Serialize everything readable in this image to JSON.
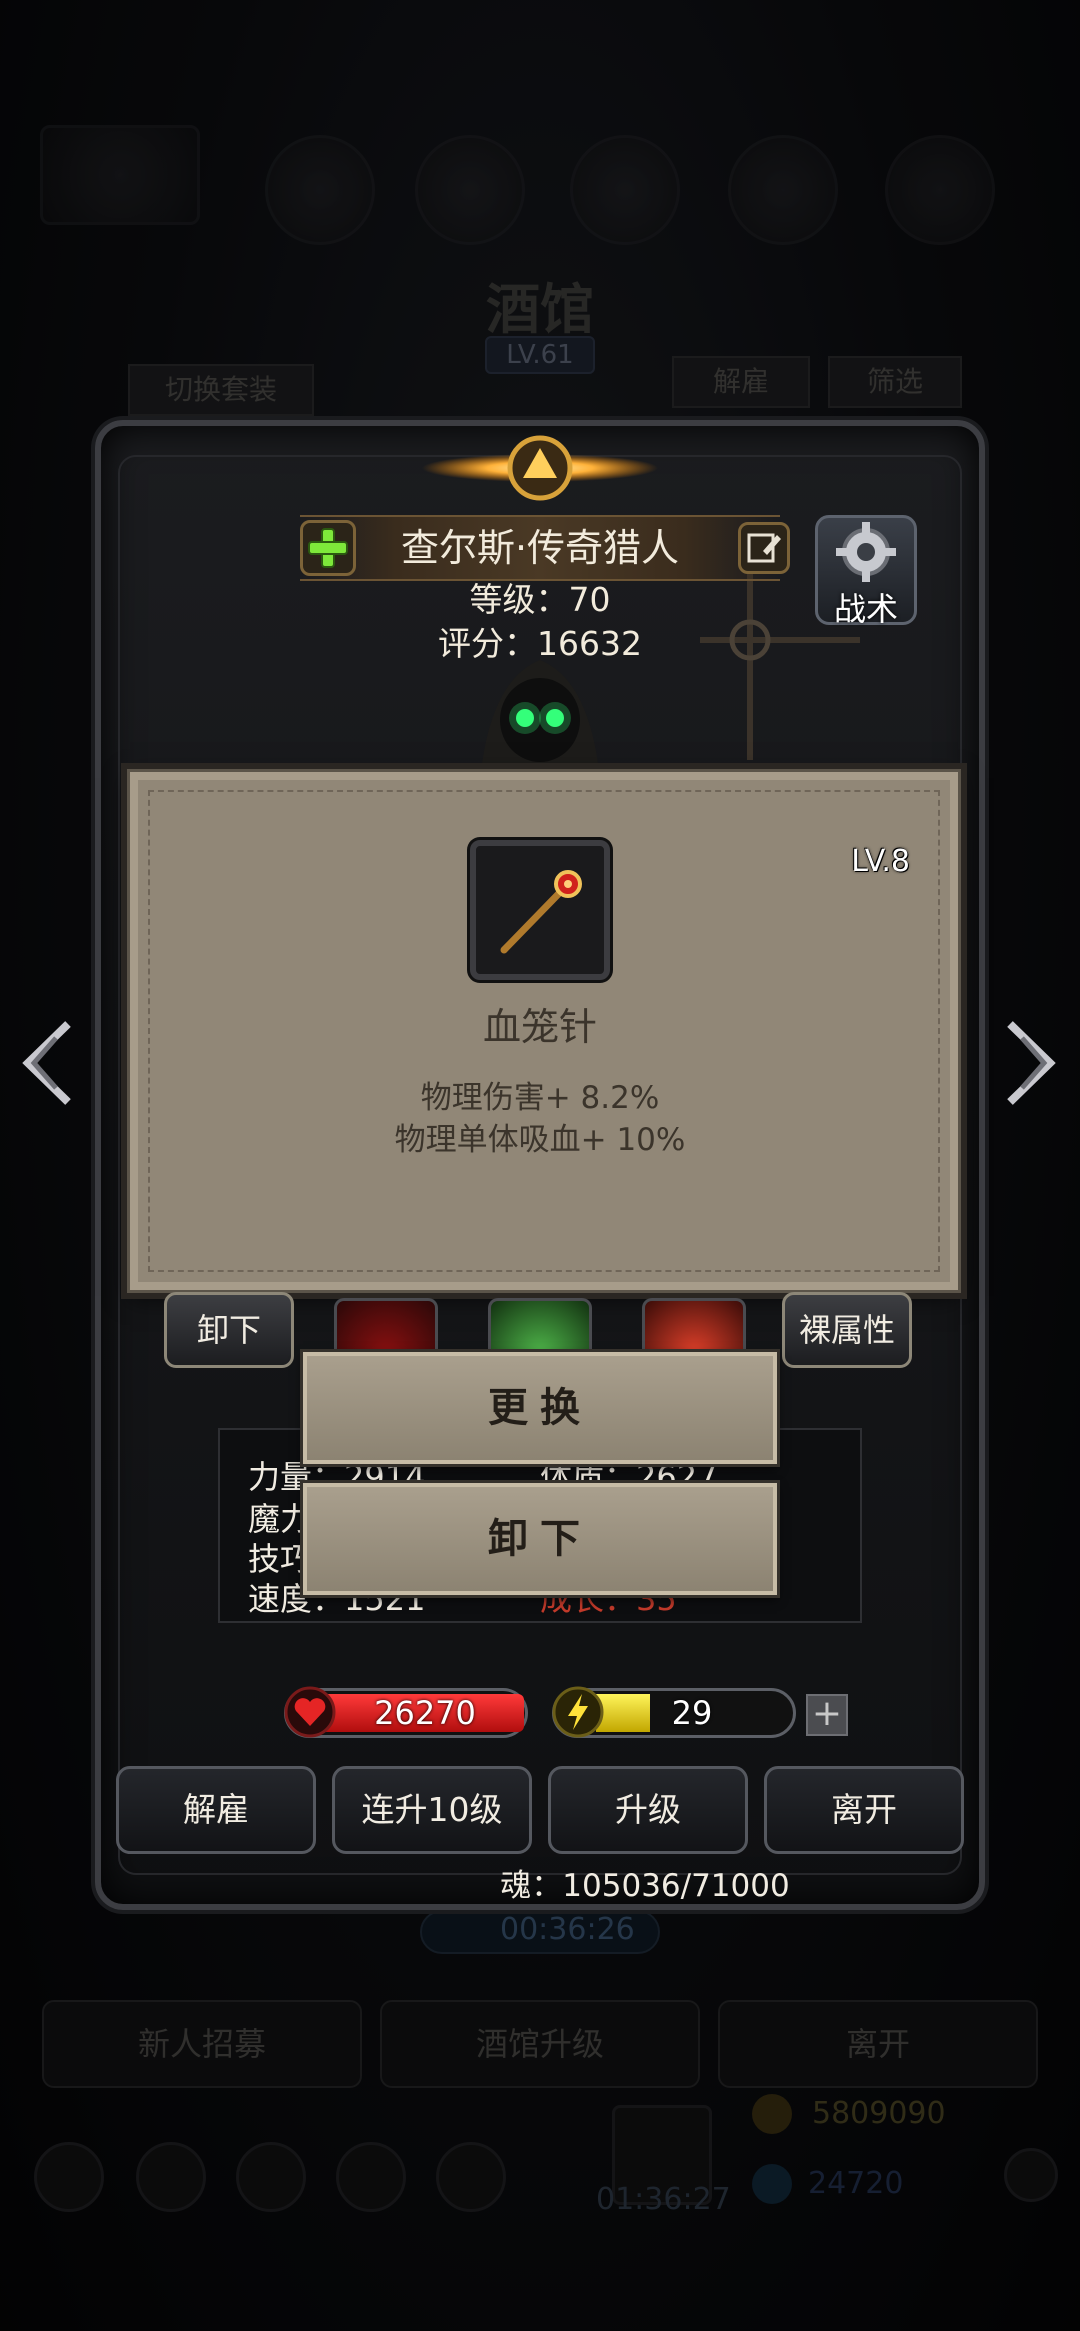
{
  "background": {
    "title": "酒馆",
    "level": "LV.61",
    "switch_set_label": "切换套装",
    "dismiss_label": "解雇",
    "filter_label": "筛选",
    "timer_top": "00:36:26",
    "recruit_label": "新人招募",
    "upgrade_tavern_label": "酒馆升级",
    "leave_label": "离开",
    "gold": "5809090",
    "gems": "24720",
    "timer_bottom": "01:36:27"
  },
  "hero": {
    "name": "查尔斯·传奇猎人",
    "level_text": "等级：70",
    "score_text": "评分：16632",
    "tactic_label": "战术"
  },
  "item": {
    "level": "LV.8",
    "name": "血笼针",
    "attributes": [
      "物理伤害+ 8.2%",
      "物理单体吸血+ 10%"
    ]
  },
  "equipment_row": {
    "unequip_label": "卸下",
    "naked_attr_label": "裸属性"
  },
  "stats": {
    "strength": "力量：2914",
    "magic": "魔力",
    "skill": "技巧",
    "speed": "速度：1521",
    "stamina": "体质：2627",
    "growth": "成长：35"
  },
  "action_menu": {
    "replace_label": "更换",
    "remove_label": "卸下"
  },
  "resources": {
    "hp": "26270",
    "hp_fraction": 1.0,
    "energy": "29",
    "energy_fraction": 0.37
  },
  "actions": {
    "dismiss_label": "解雇",
    "level10_label": "连升10级",
    "upgrade_label": "升级",
    "leave_label": "离开"
  },
  "soul_text": "魂：105036/71000",
  "colors": {
    "popup_bg": "#918777",
    "hp_red": "#d41b1b",
    "energy_yellow": "#e8d21e",
    "stat_red": "#c23a2a"
  },
  "icons": [
    "plus-icon",
    "edit-icon",
    "gear-icon",
    "heart-icon",
    "lightning-icon",
    "staff-icon",
    "chevron-left-icon",
    "chevron-right-icon"
  ]
}
